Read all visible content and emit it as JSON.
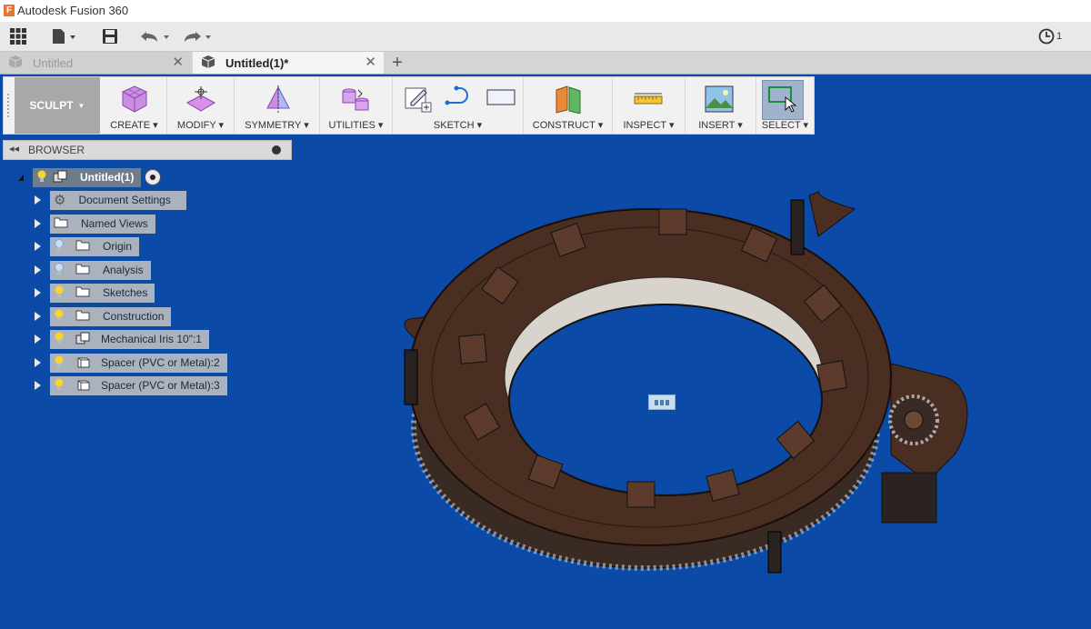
{
  "window": {
    "title": "Autodesk Fusion 360",
    "logo_letter": "F"
  },
  "quick_access": {
    "notification_count": "1"
  },
  "tabs": [
    {
      "label": "Untitled",
      "active": false
    },
    {
      "label": "Untitled(1)*",
      "active": true
    }
  ],
  "toolbar": {
    "workspace": "SCULPT",
    "groups": {
      "create": "CREATE",
      "modify": "MODIFY",
      "symmetry": "SYMMETRY",
      "utilities": "UTILITIES",
      "sketch": "SKETCH",
      "construct": "CONSTRUCT",
      "inspect": "INSPECT",
      "insert": "INSERT",
      "select": "SELECT"
    }
  },
  "browser": {
    "title": "BROWSER",
    "root": "Untitled(1)",
    "items": [
      {
        "label": "Document Settings",
        "icon": "gear-icon"
      },
      {
        "label": "Named Views",
        "icon": "folder-icon"
      },
      {
        "label": "Origin",
        "icon": "folder-icon",
        "bulb": "off"
      },
      {
        "label": "Analysis",
        "icon": "folder-icon",
        "bulb": "off"
      },
      {
        "label": "Sketches",
        "icon": "folder-icon",
        "bulb": "on"
      },
      {
        "label": "Construction",
        "icon": "folder-icon",
        "bulb": "on"
      },
      {
        "label": "Mechanical Iris 10\":1",
        "icon": "component-icon",
        "bulb": "on"
      },
      {
        "label": "Spacer (PVC or Metal):2",
        "icon": "body-icon",
        "bulb": "on"
      },
      {
        "label": "Spacer (PVC or Metal):3",
        "icon": "body-icon",
        "bulb": "on"
      }
    ]
  },
  "colors": {
    "canvas": "#0b4aa6",
    "model": "#4a2e22",
    "accent": "#e8762d"
  }
}
